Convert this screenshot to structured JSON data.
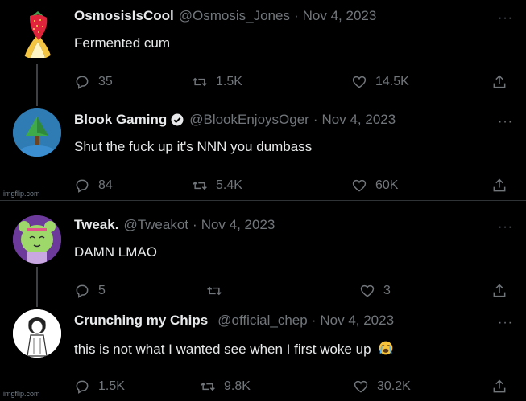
{
  "watermark": "imgflip.com",
  "screenshots": [
    {
      "tweets": [
        {
          "name": "OsmosisIsCool",
          "handle": "@Osmosis_Jones",
          "date": "Nov 4, 2023",
          "text": "Fermented cum",
          "replies": "35",
          "retweets": "1.5K",
          "likes": "14.5K",
          "verified": false,
          "avatar_icon": "strawberry-banana-icon"
        },
        {
          "name": "Blook Gaming",
          "handle": "@BlookEnjoysOger",
          "date": "Nov 4, 2023",
          "text": "Shut the fuck up it's NNN you dumbass",
          "replies": "84",
          "retweets": "5.4K",
          "likes": "60K",
          "verified": true,
          "avatar_icon": "tree-icon"
        }
      ]
    },
    {
      "tweets": [
        {
          "name": "Tweak.",
          "handle": "@Tweakot",
          "date": "Nov 4, 2023",
          "text": "DAMN LMAO",
          "replies": "5",
          "retweets": "",
          "likes": "3",
          "verified": false,
          "avatar_icon": "green-character-icon"
        },
        {
          "name": "Crunching my Chips",
          "handle": "@official_chep",
          "date": "Nov 4, 2023",
          "text": "this is not what I wanted see when I first woke up",
          "emoji": "loudly-crying-face-icon",
          "replies": "1.5K",
          "retweets": "9.8K",
          "likes": "30.2K",
          "verified": false,
          "avatar_icon": "sketch-character-icon"
        }
      ]
    }
  ],
  "more_glyph": "···",
  "colors": {
    "background": "#000000",
    "text": "#e7e9ea",
    "secondary": "#71767b",
    "verified_badge": "#e7e9ea"
  }
}
